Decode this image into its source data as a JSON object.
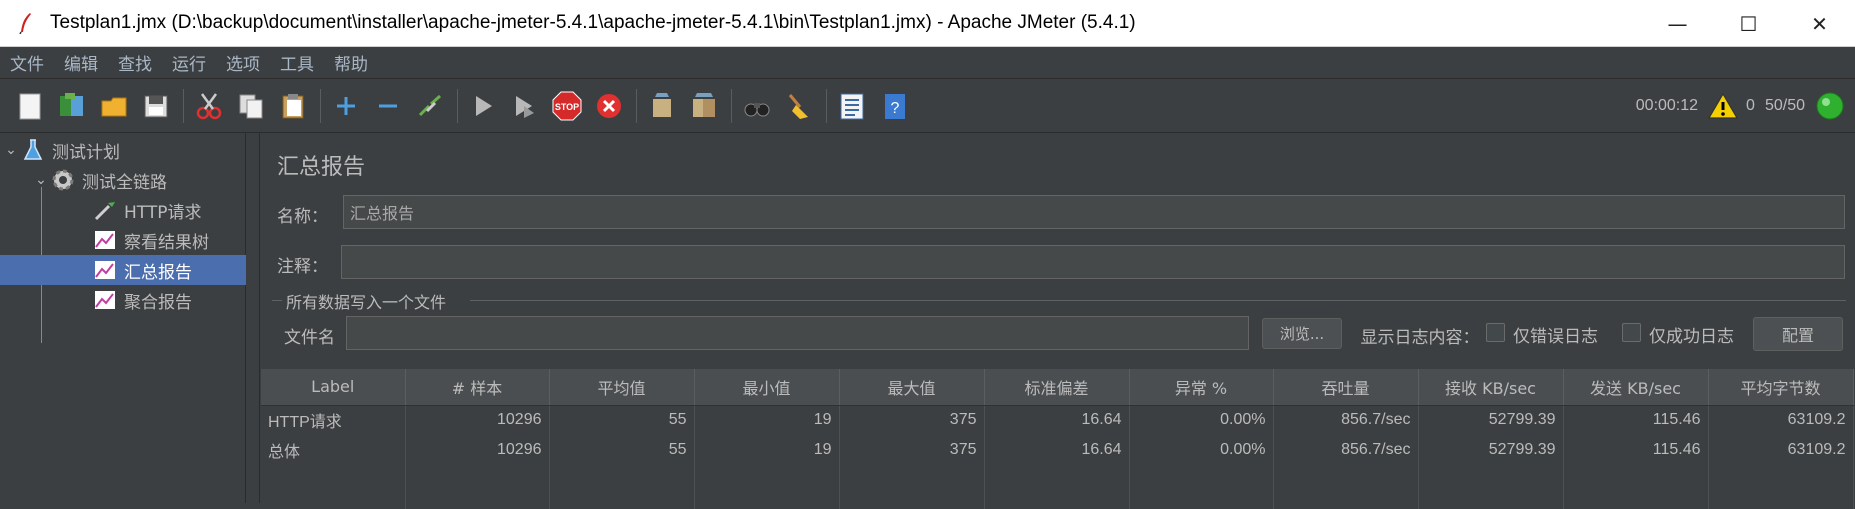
{
  "window": {
    "title": "Testplan1.jmx (D:\\backup\\document\\installer\\apache-jmeter-5.4.1\\apache-jmeter-5.4.1\\bin\\Testplan1.jmx) - Apache JMeter (5.4.1)",
    "minimize": "—",
    "maximize": "☐",
    "close": "✕"
  },
  "menu": [
    "文件",
    "编辑",
    "查找",
    "运行",
    "选项",
    "工具",
    "帮助"
  ],
  "toolbar_status": {
    "elapsed": "00:00:12",
    "errors": "0",
    "threads": "50/50"
  },
  "tree": {
    "items": [
      {
        "label": "测试计划",
        "icon": "flask-icon"
      },
      {
        "label": "测试全链路",
        "icon": "gear-icon"
      },
      {
        "label": "HTTP请求",
        "icon": "pipette-icon"
      },
      {
        "label": "察看结果树",
        "icon": "chart-icon"
      },
      {
        "label": "汇总报告",
        "icon": "chart-icon"
      },
      {
        "label": "聚合报告",
        "icon": "chart-icon"
      }
    ]
  },
  "panel": {
    "title": "汇总报告",
    "name_label": "名称：",
    "name_value": "汇总报告",
    "comment_label": "注释：",
    "comment_value": "",
    "group_title": "所有数据写入一个文件",
    "file_label": "文件名",
    "file_value": "",
    "browse_label": "浏览...",
    "log_label": "显示日志内容：",
    "errors_only_label": "仅错误日志",
    "success_only_label": "仅成功日志",
    "config_label": "配置"
  },
  "table": {
    "headers": [
      "Label",
      "# 样本",
      "平均值",
      "最小值",
      "最大值",
      "标准偏差",
      "异常 %",
      "吞吐量",
      "接收 KB/sec",
      "发送 KB/sec",
      "平均字节数"
    ],
    "rows": [
      [
        "HTTP请求",
        "10296",
        "55",
        "19",
        "375",
        "16.64",
        "0.00%",
        "856.7/sec",
        "52799.39",
        "115.46",
        "63109.2"
      ],
      [
        "总体",
        "10296",
        "55",
        "19",
        "375",
        "16.64",
        "0.00%",
        "856.7/sec",
        "52799.39",
        "115.46",
        "63109.2"
      ]
    ]
  }
}
